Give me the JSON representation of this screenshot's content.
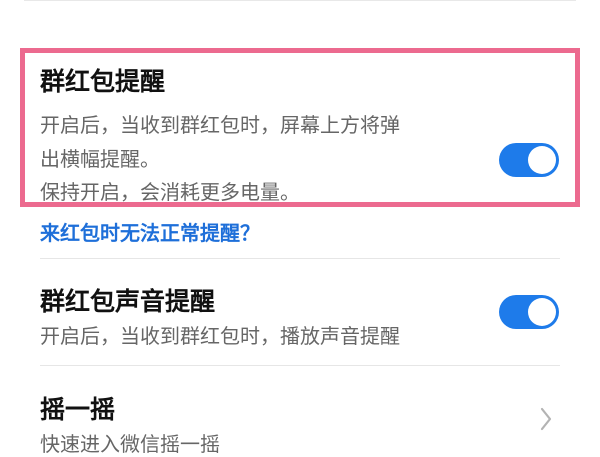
{
  "settings": {
    "group_red_packet_alert": {
      "title": "群红包提醒",
      "desc_line1": "开启后，当收到群红包时，屏幕上方将弹",
      "desc_line2": "出横幅提醒。",
      "desc_line3": "保持开启，会消耗更多电量。",
      "enabled": true
    },
    "help_link": "来红包时无法正常提醒？",
    "group_red_packet_sound": {
      "title": "群红包声音提醒",
      "desc": "开启后，当收到群红包时，播放声音提醒",
      "enabled": true
    },
    "shake": {
      "title": "摇一摇",
      "desc": "快速进入微信摇一摇",
      "chevron_icon": "chevron-right-icon"
    }
  },
  "colors": {
    "accent": "#1e7bea",
    "highlight_border": "#ec6a8f",
    "link": "#1e6fd9"
  }
}
